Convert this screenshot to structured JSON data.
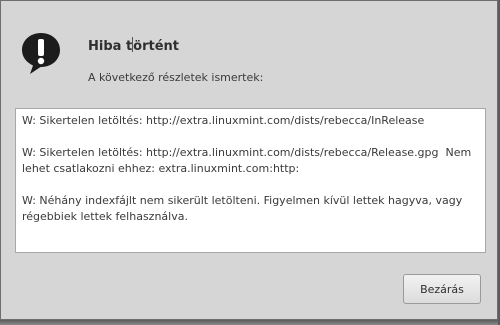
{
  "dialog": {
    "icon": "speech-bubble-exclamation-icon",
    "title_before_caret": "Hiba t",
    "title_after_caret": "örtént",
    "subtitle": "A következő részletek ismertek:",
    "details": [
      "W: Sikertelen letöltés: http://extra.linuxmint.com/dists/rebecca/InRelease",
      "",
      "W: Sikertelen letöltés: http://extra.linuxmint.com/dists/rebecca/Release.gpg  Nem lehet csatlakozni ehhez: extra.linuxmint.com:http:",
      "",
      "W: Néhány indexfájlt nem sikerült letölteni. Figyelmen kívül lettek hagyva, vagy régebbiek lettek felhasználva."
    ],
    "close_label": "Bezárás"
  },
  "colors": {
    "dialog_background": "#d6d6d6",
    "icon_color": "#1c1c1c"
  }
}
